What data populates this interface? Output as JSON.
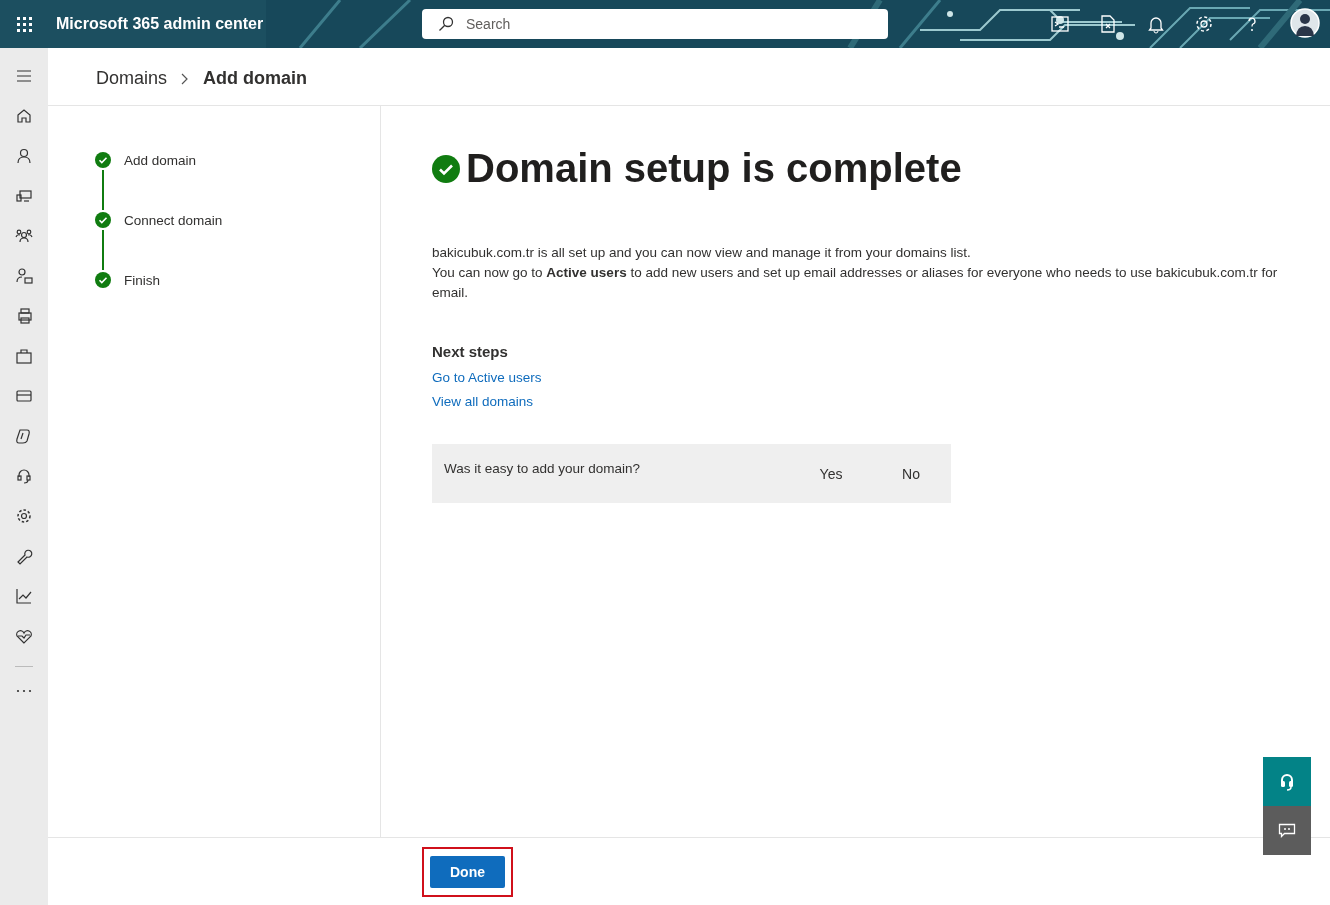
{
  "header": {
    "title": "Microsoft 365 admin center",
    "search": {
      "placeholder": "Search"
    }
  },
  "breadcrumb": [
    {
      "label": "Domains",
      "current": false
    },
    {
      "label": "Add domain",
      "current": true
    }
  ],
  "steps": [
    {
      "label": "Add domain",
      "completed": true
    },
    {
      "label": "Connect domain",
      "completed": true
    },
    {
      "label": "Finish",
      "completed": true
    }
  ],
  "heading": "Domain setup is complete",
  "paragraphs": [
    "bakicubuk.com.tr is all set up and you can now view and manage it from your domains list.",
    "You can now go to **Active users** to add new users and set up email addresses or aliases for everyone who needs to use bakicubuk.com.tr for email."
  ],
  "next_steps": {
    "title": "Next steps",
    "links": [
      "Go to Active users",
      "View all domains"
    ]
  },
  "feedback": {
    "question": "Was it easy to add your domain?",
    "options": [
      "Yes",
      "No"
    ]
  },
  "footer": {
    "button": "Done"
  }
}
